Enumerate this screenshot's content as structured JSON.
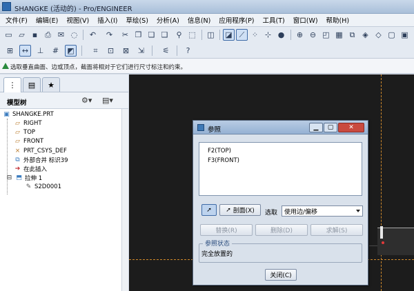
{
  "window": {
    "title": "SHANGKE (活动的) - Pro/ENGINEER"
  },
  "menu": [
    "文件(F)",
    "编辑(E)",
    "视图(V)",
    "插入(I)",
    "草绘(S)",
    "分析(A)",
    "信息(N)",
    "应用程序(P)",
    "工具(T)",
    "窗口(W)",
    "帮助(H)"
  ],
  "hint": {
    "text": "选取垂直曲面、边或顶点，截面将相对于它们进行尺寸标注和约束。"
  },
  "model_tree": {
    "label": "模型树",
    "items": [
      {
        "label": "SHANGKE.PRT",
        "icon": "part-icon"
      },
      {
        "label": "RIGHT",
        "icon": "datum-plane-icon"
      },
      {
        "label": "TOP",
        "icon": "datum-plane-icon"
      },
      {
        "label": "FRONT",
        "icon": "datum-plane-icon"
      },
      {
        "label": "PRT_CSYS_DEF",
        "icon": "csys-icon"
      },
      {
        "label": "外部合并 标识39",
        "icon": "merge-icon"
      },
      {
        "label": "在此插入",
        "icon": "insert-here-arrow-icon"
      },
      {
        "label": "拉伸 1",
        "icon": "extrude-icon"
      },
      {
        "label": "S2D0001",
        "icon": "sketch-icon"
      }
    ]
  },
  "dialog": {
    "title": "参照",
    "references": [
      "F2(TOP)",
      "F3(FRONT)"
    ],
    "section_label": "剖面(X)",
    "select_label": "选取",
    "select_value": "使用边/偏移",
    "replace_label": "替换(R)",
    "delete_label": "删除(D)",
    "solve_label": "求解(S)",
    "status_legend": "参照状态",
    "status_text": "完全放置的",
    "close_label": "关闭(C)"
  },
  "colors": {
    "graphics_bg": "#1c1c1c",
    "datum_dash": "#d28a2a",
    "dialog_bg": "#d9e1eb"
  }
}
